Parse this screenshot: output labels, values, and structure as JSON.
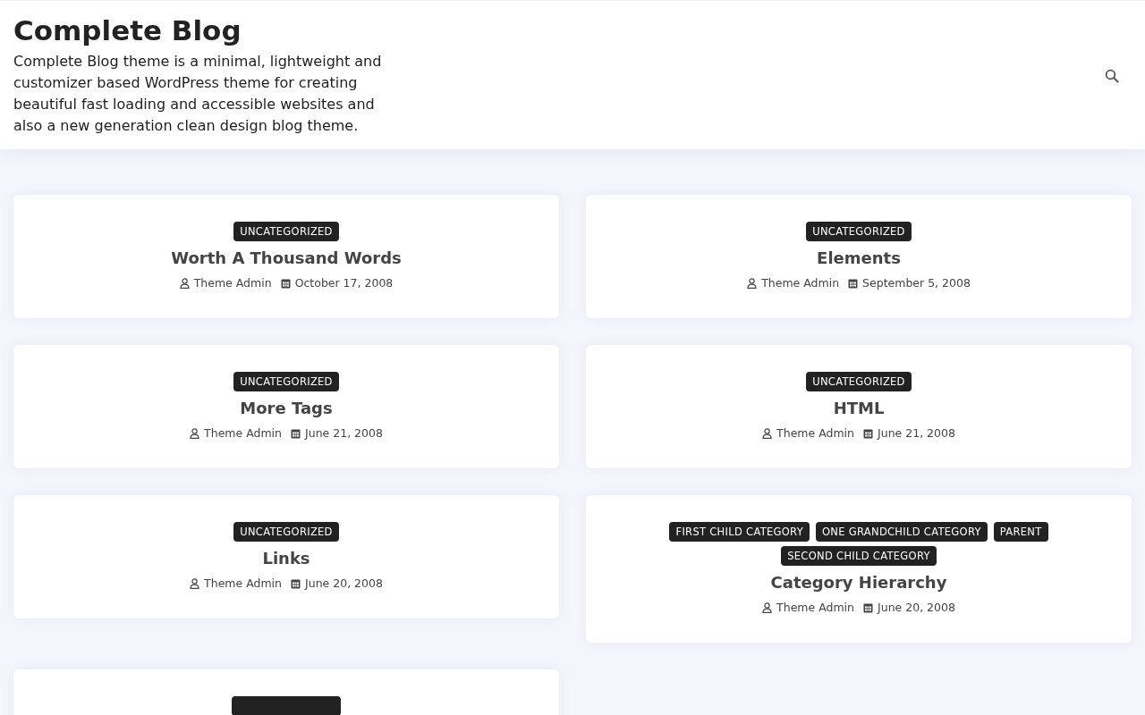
{
  "site": {
    "title": "Complete Blog",
    "description": "Complete Blog theme is a minimal, lightweight and customizer based WordPress theme for creating beautiful fast loading and accessible websites and also a new generation clean design blog theme."
  },
  "posts": [
    {
      "categories": [
        "UNCATEGORIZED"
      ],
      "title": "Worth A Thousand Words",
      "author": "Theme Admin",
      "date": "October 17, 2008"
    },
    {
      "categories": [
        "UNCATEGORIZED"
      ],
      "title": "Elements",
      "author": "Theme Admin",
      "date": "September 5, 2008"
    },
    {
      "categories": [
        "UNCATEGORIZED"
      ],
      "title": "More Tags",
      "author": "Theme Admin",
      "date": "June 21, 2008"
    },
    {
      "categories": [
        "UNCATEGORIZED"
      ],
      "title": "HTML",
      "author": "Theme Admin",
      "date": "June 21, 2008"
    },
    {
      "categories": [
        "UNCATEGORIZED"
      ],
      "title": "Links",
      "author": "Theme Admin",
      "date": "June 20, 2008"
    },
    {
      "categories": [
        "FIRST CHILD CATEGORY",
        "ONE GRANDCHILD CATEGORY",
        "PARENT",
        "SECOND CHILD CATEGORY"
      ],
      "title": "Category Hierarchy",
      "author": "Theme Admin",
      "date": "June 20, 2008"
    }
  ]
}
